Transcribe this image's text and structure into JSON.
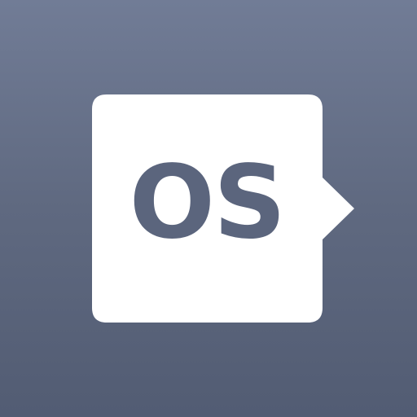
{
  "logo": {
    "text": "OS",
    "card_color": "#ffffff",
    "text_color": "#5b657d"
  },
  "background": {
    "gradient_top": "#717c96",
    "gradient_bottom": "#525c73"
  }
}
